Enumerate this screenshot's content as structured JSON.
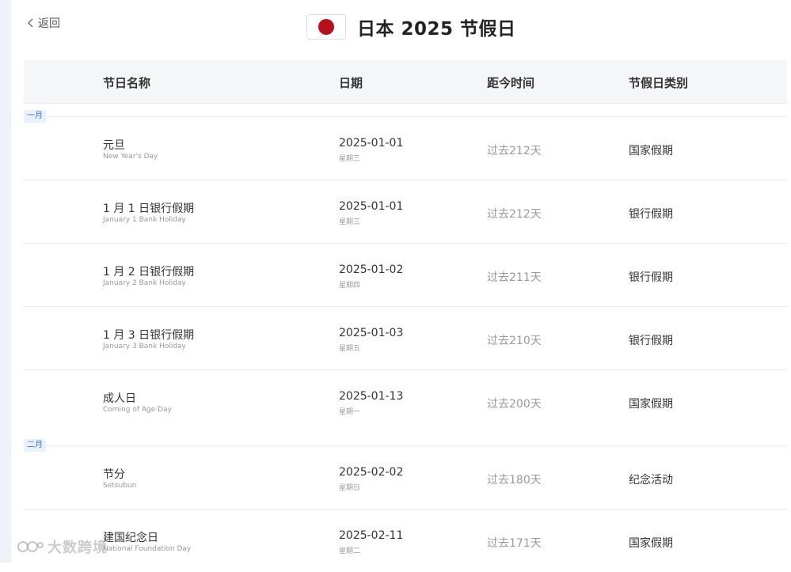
{
  "back": {
    "label": "返回",
    "icon": "chevron-left-icon"
  },
  "header": {
    "flag_icon": "japan-flag-icon",
    "title": "日本 2025 节假日",
    "flag_color": "#b3121d"
  },
  "table": {
    "columns": {
      "name": "节日名称",
      "date": "日期",
      "distance": "距今时间",
      "type": "节假日类别"
    },
    "months": [
      {
        "label": "一月",
        "rows": [
          {
            "name": "元旦",
            "name_en": "New Year's Day",
            "date": "2025-01-01",
            "weekday": "星期三",
            "distance": "过去212天",
            "type": "国家假期"
          },
          {
            "name": "1 月 1 日银行假期",
            "name_en": "January 1 Bank Holiday",
            "date": "2025-01-01",
            "weekday": "星期三",
            "distance": "过去212天",
            "type": "银行假期"
          },
          {
            "name": "1 月 2 日银行假期",
            "name_en": "January 2 Bank Holiday",
            "date": "2025-01-02",
            "weekday": "星期四",
            "distance": "过去211天",
            "type": "银行假期"
          },
          {
            "name": "1 月 3 日银行假期",
            "name_en": "January 3 Bank Holiday",
            "date": "2025-01-03",
            "weekday": "星期五",
            "distance": "过去210天",
            "type": "银行假期"
          },
          {
            "name": "成人日",
            "name_en": "Coming of Age Day",
            "date": "2025-01-13",
            "weekday": "星期一",
            "distance": "过去200天",
            "type": "国家假期"
          }
        ]
      },
      {
        "label": "二月",
        "rows": [
          {
            "name": "节分",
            "name_en": "Setsubun",
            "date": "2025-02-02",
            "weekday": "星期日",
            "distance": "过去180天",
            "type": "纪念活动"
          },
          {
            "name": "建国纪念日",
            "name_en": "National Foundation Day",
            "date": "2025-02-11",
            "weekday": "星期二",
            "distance": "过去171天",
            "type": "国家假期"
          }
        ]
      }
    ]
  },
  "watermark": {
    "text": "大数跨境",
    "icon": "brand-logo-icon"
  }
}
